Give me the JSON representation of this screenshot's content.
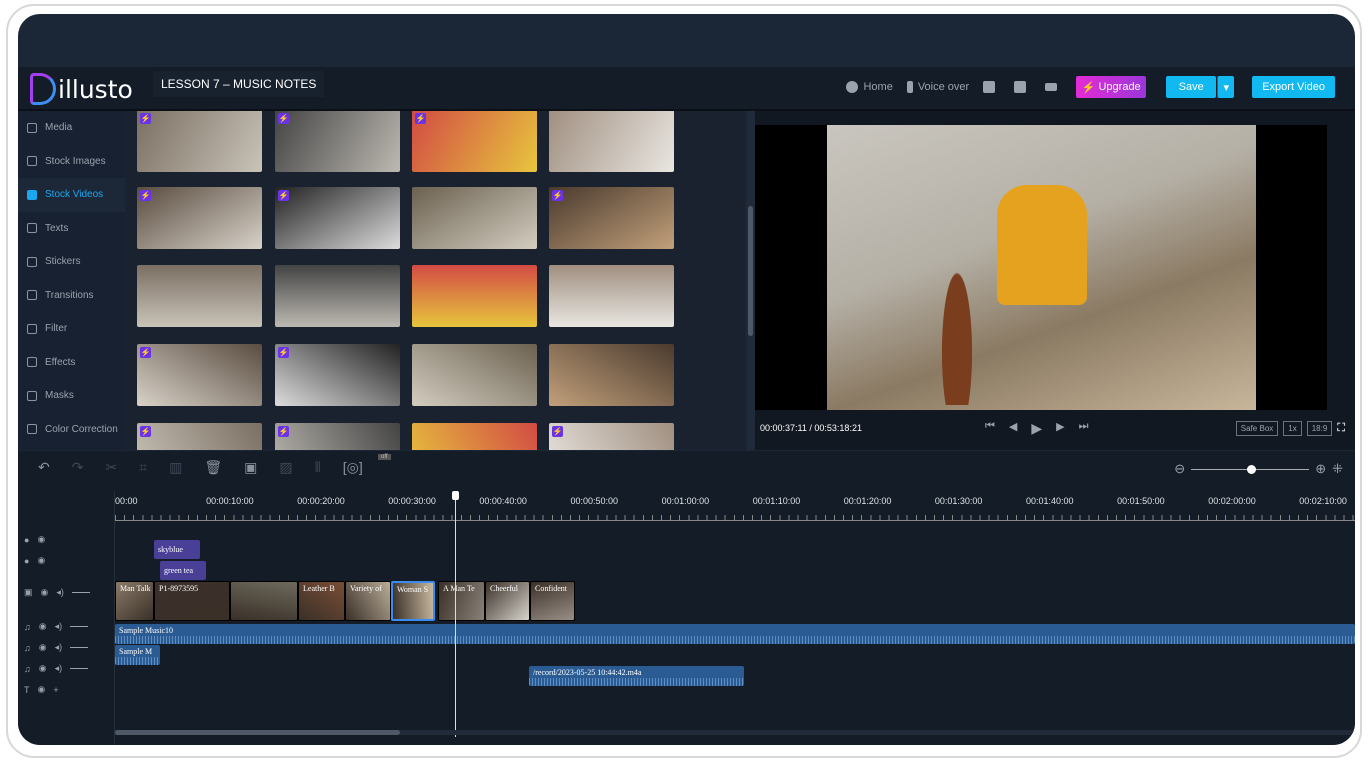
{
  "header": {
    "logo": "illusto",
    "project_title": "LESSON 7 – MUSIC NOTES",
    "home": "Home",
    "voice_over": "Voice over",
    "upgrade": "Upgrade",
    "save": "Save",
    "export": "Export Video"
  },
  "sidebar": {
    "items": [
      {
        "label": "Media",
        "icon": "layers-icon"
      },
      {
        "label": "Stock Images",
        "icon": "layers-icon"
      },
      {
        "label": "Stock Videos",
        "icon": "layers-icon",
        "active": true
      },
      {
        "label": "Texts",
        "icon": "text-box-icon"
      },
      {
        "label": "Stickers",
        "icon": "smiley-icon"
      },
      {
        "label": "Transitions",
        "icon": "transition-icon"
      },
      {
        "label": "Filter",
        "icon": "filter-circles-icon"
      },
      {
        "label": "Effects",
        "icon": "magic-wand-icon"
      },
      {
        "label": "Masks",
        "icon": "mask-icon"
      },
      {
        "label": "Color Correction",
        "icon": "sliders-icon"
      }
    ]
  },
  "stock_grid": {
    "premium_badges": [
      [
        true,
        true,
        true,
        false
      ],
      [
        true,
        true,
        false,
        true
      ],
      [
        false,
        false,
        false,
        false
      ],
      [
        true,
        true,
        false,
        false
      ],
      [
        true,
        true,
        false,
        true
      ]
    ]
  },
  "preview": {
    "time_current": "00:00:37:11",
    "time_total": "00:53:18:21",
    "time_sep": " / ",
    "safe_box": "Safe Box",
    "speed": "1x",
    "ratio": "18:9"
  },
  "timeline": {
    "snap_label": "off",
    "zoom_level": 0.55,
    "ruler": [
      "00:00",
      "00:00:10:00",
      "00:00:20:00",
      "00:00:30:00",
      "00:00:40:00",
      "00:00:50:00",
      "00:01:00:00",
      "00:01:10:00",
      "00:01:20:00",
      "00:01:30:00",
      "00:01:40:00",
      "00:01:50:00",
      "00:02:00:00",
      "00:02:10:00"
    ],
    "effects": [
      "skyblue",
      "green tea"
    ],
    "video_clips": [
      "Man Talk",
      "P1-8973595",
      "",
      "Leather B",
      "Variety of",
      "Woman S",
      "A Man Te",
      "Cheerful",
      "Confident"
    ],
    "audio_clips": [
      "Sample Music10",
      "Sample M",
      "/record/2023-05-25 10:44:42.m4a"
    ]
  }
}
